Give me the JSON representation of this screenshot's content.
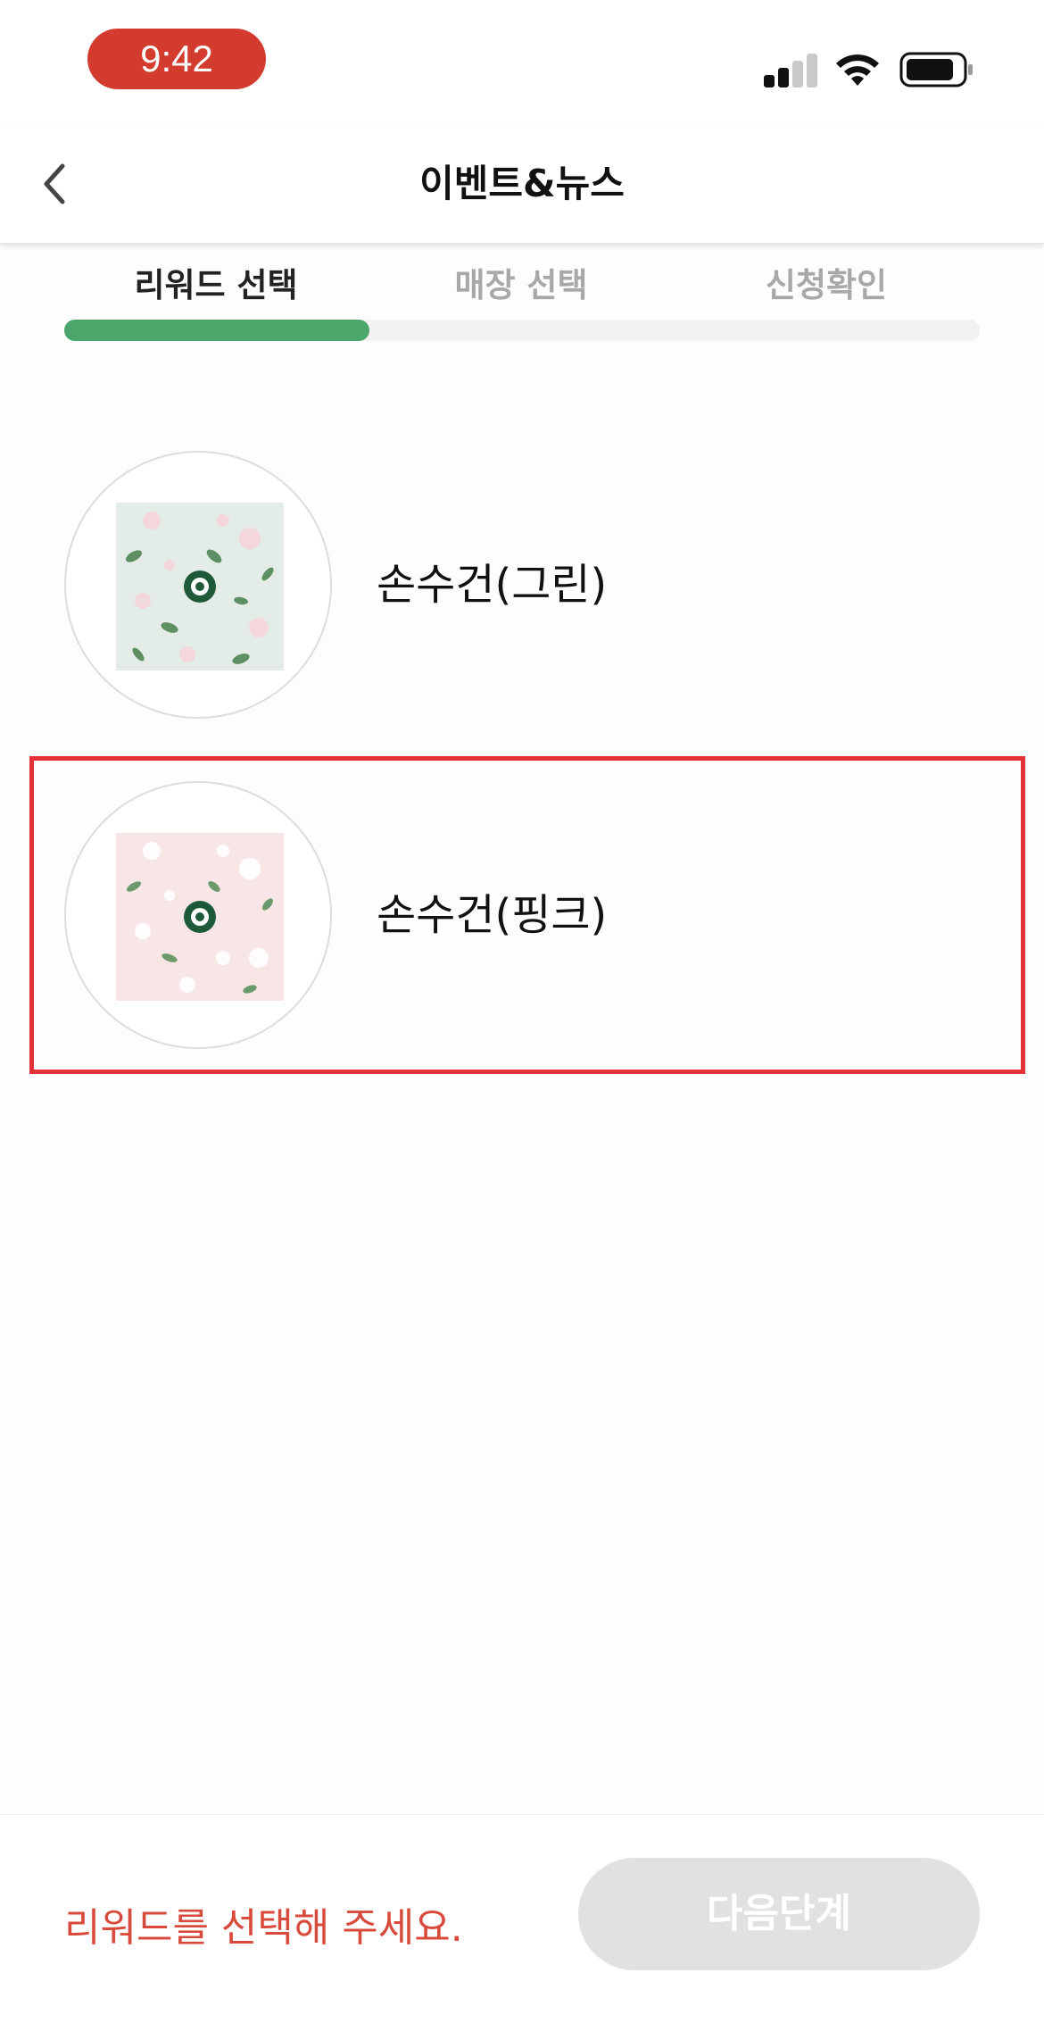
{
  "status_bar": {
    "time": "9:42"
  },
  "header": {
    "title": "이벤트&뉴스",
    "back_icon": "chevron-left-icon"
  },
  "steps": {
    "items": [
      {
        "label": "리워드 선택",
        "active": true
      },
      {
        "label": "매장 선택",
        "active": false
      },
      {
        "label": "신청확인",
        "active": false
      }
    ],
    "progress": 0.333
  },
  "rewards": [
    {
      "label": "손수건(그린)",
      "selected": false,
      "bg_color": "#e3ece6"
    },
    {
      "label": "손수건(핑크)",
      "selected": true,
      "bg_color": "#f8e6e6"
    }
  ],
  "bottom": {
    "hint": "리워드를 선택해 주세요.",
    "next_label": "다음단계"
  },
  "colors": {
    "accent_green": "#4aa66a",
    "time_pill": "#d33b2f",
    "hint_red": "#d84b3c",
    "selection_outline": "#e53238",
    "disabled_button": "#e1e1e1"
  }
}
